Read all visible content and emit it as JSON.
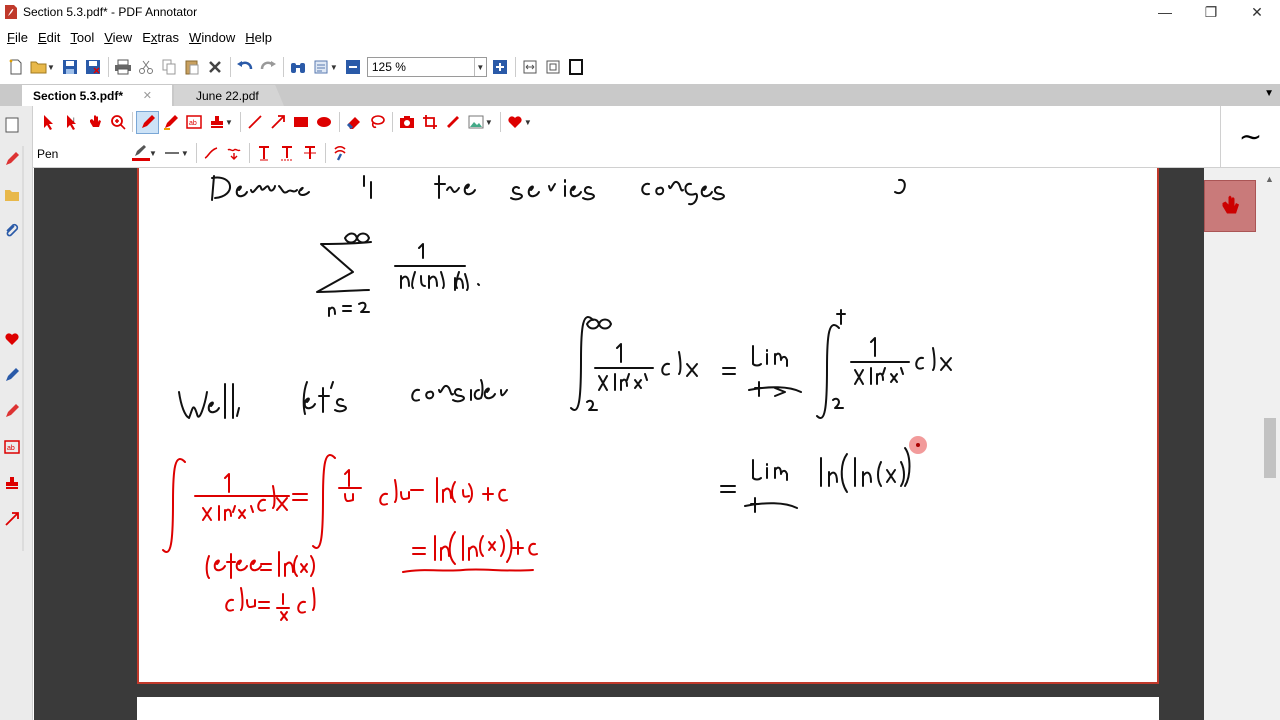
{
  "window": {
    "title": "Section 5.3.pdf* - PDF Annotator",
    "minimize": "—",
    "restore": "❐",
    "close": "✕"
  },
  "menu": {
    "items": [
      "File",
      "Edit",
      "Tool",
      "View",
      "Extras",
      "Window",
      "Help"
    ],
    "underline": [
      "F",
      "E",
      "T",
      "V",
      "x",
      "W",
      "H"
    ]
  },
  "toolbar": {
    "zoom_value": "125 %"
  },
  "tabs": {
    "active": "Section 5.3.pdf*",
    "inactive": "June 22.pdf",
    "close_glyph": "✕"
  },
  "annotation_toolbar": {
    "current_tool_label": "Pen"
  },
  "right_panel": {
    "stroke_glyph": "∼"
  },
  "colors": {
    "accent_red": "#d00000",
    "page_border": "#c0392b",
    "doc_background": "#3a3a3a",
    "tab_bar": "#c9c9c9",
    "favorite_tool_bg": "#c97a7a"
  },
  "document": {
    "handwriting_black": [
      "Determine if the series converges",
      "∑ n=2 to ∞ of 1/(n ln(n))",
      "Well, let's consider",
      "∫ 2 to ∞ 1/(x ln(x)) dx = lim t→∞ ∫ 2 to t 1/(x ln(x)) dx",
      "= lim t→∞ ln(ln(x))"
    ],
    "handwriting_red": [
      "∫ 1/(x ln(x)) dx = ∫ 1/u du = ln(u) + C",
      "= ln(ln(x)) + C",
      "let u = ln(x)",
      "du = 1/x dx"
    ]
  }
}
